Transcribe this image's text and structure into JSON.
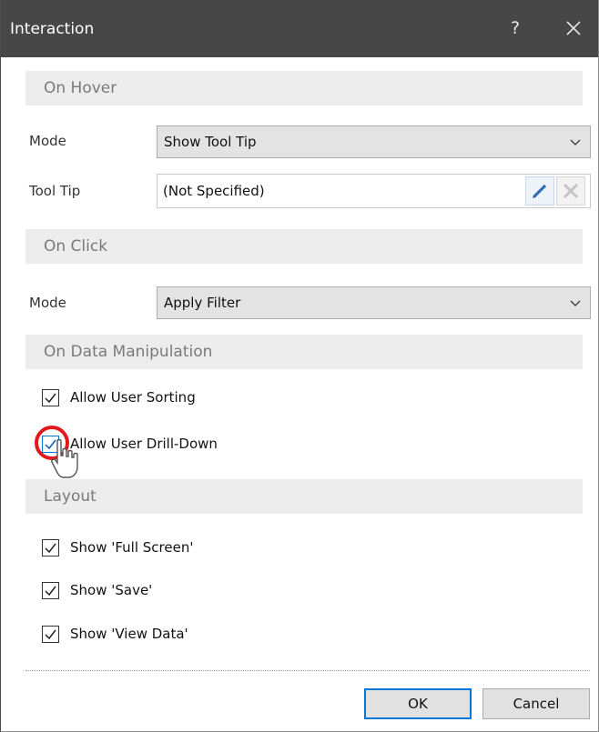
{
  "window": {
    "title": "Interaction",
    "help_label": "?"
  },
  "sections": {
    "on_hover": "On Hover",
    "on_click": "On Click",
    "on_data_manipulation": "On Data Manipulation",
    "layout": "Layout"
  },
  "hover": {
    "mode_label": "Mode",
    "mode_value": "Show Tool Tip",
    "tooltip_label": "Tool Tip",
    "tooltip_value": "(Not Specified)"
  },
  "click": {
    "mode_label": "Mode",
    "mode_value": "Apply Filter"
  },
  "data_manipulation": {
    "allow_sorting": {
      "label": "Allow User Sorting",
      "checked": true
    },
    "allow_drilldown": {
      "label": "Allow User Drill-Down",
      "checked": true
    }
  },
  "layout": {
    "show_full_screen": {
      "label": "Show 'Full Screen'",
      "checked": true
    },
    "show_save": {
      "label": "Show 'Save'",
      "checked": true
    },
    "show_view_data": {
      "label": "Show 'View Data'",
      "checked": true
    }
  },
  "buttons": {
    "ok": "OK",
    "cancel": "Cancel"
  },
  "icons": {
    "help": "help-icon",
    "close": "close-icon",
    "edit": "pencil-icon",
    "clear": "clear-x-icon",
    "chevron": "chevron-down-icon",
    "cursor": "mouse-pointer-icon"
  },
  "colors": {
    "titlebar": "#474747",
    "section_bg": "#ececec",
    "focus_border": "#0078d7",
    "highlight_ring": "#e0191e"
  }
}
